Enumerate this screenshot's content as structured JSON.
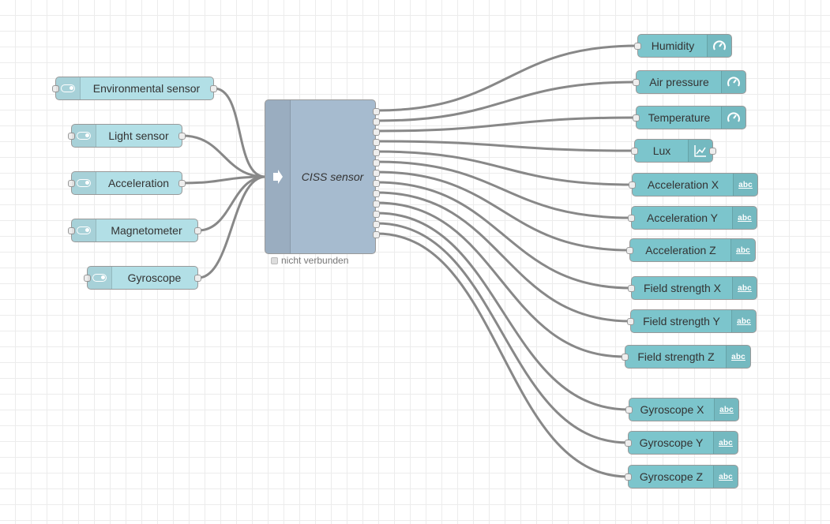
{
  "inputs": [
    {
      "label": "Environmental sensor",
      "icon": "toggle-icon"
    },
    {
      "label": "Light sensor",
      "icon": "toggle-icon"
    },
    {
      "label": "Acceleration",
      "icon": "toggle-icon"
    },
    {
      "label": "Magnetometer",
      "icon": "toggle-icon"
    },
    {
      "label": "Gyroscope",
      "icon": "toggle-icon"
    }
  ],
  "central": {
    "label": "CISS sensor",
    "icon": "arrow-right-icon",
    "status": "nicht verbunden"
  },
  "outputs": [
    {
      "label": "Humidity",
      "icon": "gauge-icon"
    },
    {
      "label": "Air pressure",
      "icon": "gauge-icon"
    },
    {
      "label": "Temperature",
      "icon": "gauge-icon"
    },
    {
      "label": "Lux",
      "icon": "chart-icon"
    },
    {
      "label": "Acceleration X",
      "icon": "abc-text-icon",
      "icon_text": "abc"
    },
    {
      "label": "Acceleration Y",
      "icon": "abc-text-icon",
      "icon_text": "abc"
    },
    {
      "label": "Acceleration Z",
      "icon": "abc-text-icon",
      "icon_text": "abc"
    },
    {
      "label": "Field strength X",
      "icon": "abc-text-icon",
      "icon_text": "abc"
    },
    {
      "label": "Field strength Y",
      "icon": "abc-text-icon",
      "icon_text": "abc"
    },
    {
      "label": "Field strength Z",
      "icon": "abc-text-icon",
      "icon_text": "abc"
    },
    {
      "label": "Gyroscope X",
      "icon": "abc-text-icon",
      "icon_text": "abc"
    },
    {
      "label": "Gyroscope Y",
      "icon": "abc-text-icon",
      "icon_text": "abc"
    },
    {
      "label": "Gyroscope Z",
      "icon": "abc-text-icon",
      "icon_text": "abc"
    }
  ],
  "colors": {
    "inject": "#b2dfe6",
    "output": "#7cc5cc",
    "function": "#a6bbcf",
    "wire": "#888888"
  }
}
